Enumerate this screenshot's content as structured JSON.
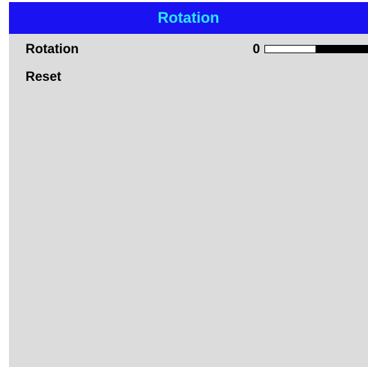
{
  "header": {
    "title": "Rotation"
  },
  "menu": {
    "items": [
      {
        "label": "Rotation",
        "value": "0",
        "slider_level": 0.5
      },
      {
        "label": "Reset"
      }
    ]
  },
  "colors": {
    "title_bar": "#1a12f0",
    "title_text": "#29e6ff",
    "panel_background": "#dcdcdc",
    "slider_fill": "#000000",
    "slider_empty": "#ffffff"
  }
}
